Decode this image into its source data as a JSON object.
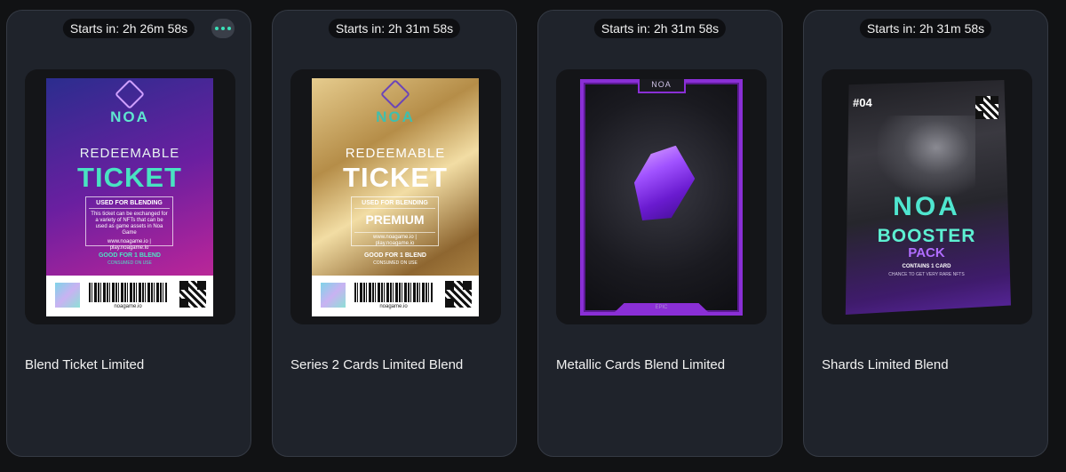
{
  "cards": [
    {
      "timer": "Starts in: 2h 26m 58s",
      "title": "Blend Ticket Limited",
      "art": {
        "logo": "NOA",
        "redeem": "REDEEMABLE",
        "ticket": "TICKET",
        "used_for": "USED FOR BLENDING",
        "body": "This ticket can be exchanged for a variety of NFTs that can be used as game assets in Noa Game",
        "links": "www.noagame.io | play.noagame.io",
        "good_for": "GOOD FOR 1 BLEND",
        "consumed": "CONSUMED ON USE",
        "barcode_url": "noagame.io"
      }
    },
    {
      "timer": "Starts in: 2h 31m 58s",
      "title": "Series 2 Cards Limited Blend",
      "art": {
        "logo": "NOA",
        "redeem": "REDEEMABLE",
        "ticket": "TICKET",
        "used_for": "USED FOR BLENDING",
        "premium": "PREMIUM",
        "links": "www.noagame.io | play.noagame.io",
        "good_for": "GOOD FOR 1 BLEND",
        "consumed": "CONSUMED ON USE",
        "barcode_url": "noagame.io"
      }
    },
    {
      "timer": "Starts in: 2h 31m 58s",
      "title": "Metallic Cards Blend Limited",
      "art": {
        "logo": "NOA",
        "rarity": "EPIC"
      }
    },
    {
      "timer": "Starts in: 2h 31m 58s",
      "title": "Shards Limited Blend",
      "art": {
        "number": "#04",
        "logo": "NOA",
        "booster": "BOOSTER",
        "pack": "PACK",
        "contains": "CONTAINS 1 CARD",
        "chance": "CHANCE TO GET VERY RARE NFTS"
      }
    }
  ],
  "icons": {
    "more": "more-options-icon"
  },
  "colors": {
    "accent": "#3be0b8",
    "card_bg": "#1f232b",
    "page_bg": "#111214"
  }
}
